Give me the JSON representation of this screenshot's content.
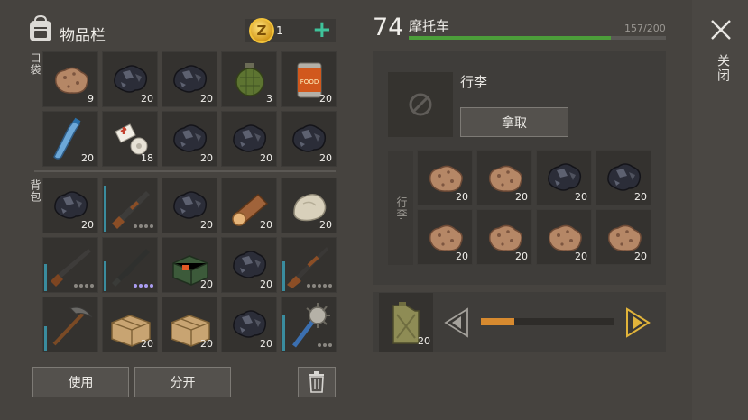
{
  "header": {
    "title": "物品栏",
    "coin_symbol": "Z",
    "coins": "1"
  },
  "labels": {
    "pocket": "口袋",
    "backpack": "背包"
  },
  "pocket": [
    {
      "item": "ore-rock",
      "count": "9"
    },
    {
      "item": "coal",
      "count": "20"
    },
    {
      "item": "coal",
      "count": "20"
    },
    {
      "item": "grenade",
      "count": "3"
    },
    {
      "item": "canned-food",
      "count": "20"
    },
    {
      "item": "water-bottle",
      "count": "20"
    },
    {
      "item": "bandage",
      "count": "18"
    },
    {
      "item": "coal",
      "count": "20"
    },
    {
      "item": "coal",
      "count": "20"
    },
    {
      "item": "coal",
      "count": "20"
    }
  ],
  "backpack": [
    {
      "item": "coal",
      "count": "20"
    },
    {
      "item": "pump-shotgun",
      "dots": 4,
      "durability": 0.85
    },
    {
      "item": "coal",
      "count": "20"
    },
    {
      "item": "wood-log",
      "count": "20"
    },
    {
      "item": "stone",
      "count": "20"
    },
    {
      "item": "shotgun",
      "dots": 4,
      "durability": 0.5
    },
    {
      "item": "assault-rifle",
      "dots": 4,
      "dots_purple": true,
      "durability": 0.55
    },
    {
      "item": "military-box",
      "count": "20"
    },
    {
      "item": "coal",
      "count": "20"
    },
    {
      "item": "hunting-rifle",
      "dots": 5,
      "durability": 0.55
    },
    {
      "item": "pickaxe",
      "durability": 0.45
    },
    {
      "item": "cardboard-box",
      "count": "20"
    },
    {
      "item": "cardboard-box",
      "count": "20"
    },
    {
      "item": "coal",
      "count": "20"
    },
    {
      "item": "spiked-club",
      "dots": 3,
      "durability": 0.65
    }
  ],
  "buttons": {
    "use": "使用",
    "split": "分开",
    "take": "拿取"
  },
  "vehicle": {
    "number": "74",
    "name": "摩托车",
    "fuel": "157/200",
    "hp_fraction": 0.785
  },
  "close_label": "关闭",
  "luggage": {
    "title": "行李",
    "label": "行李",
    "items": [
      {
        "item": "ore-rock",
        "count": "20"
      },
      {
        "item": "ore-rock",
        "count": "20"
      },
      {
        "item": "coal",
        "count": "20"
      },
      {
        "item": "coal",
        "count": "20"
      },
      {
        "item": "ore-rock",
        "count": "20"
      },
      {
        "item": "ore-rock",
        "count": "20"
      },
      {
        "item": "ore-rock",
        "count": "20"
      },
      {
        "item": "ore-rock",
        "count": "20"
      }
    ]
  },
  "fuel_slot": {
    "item": "jerrycan",
    "count": "20",
    "slider_fraction": 0.25
  },
  "colors": {
    "accent_green": "#3fc29a",
    "hp_green": "#4c9e3a",
    "slider_orange": "#d78a2f",
    "durability_teal": "#3a8c9e"
  }
}
